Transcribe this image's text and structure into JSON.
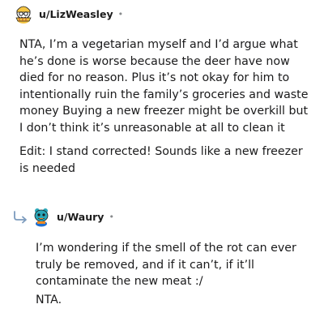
{
  "top_comment": {
    "username": "u/LizWeasley",
    "separator": "•",
    "body_paragraph_1": "NTA, I’m a vegetarian myself and I’d argue what he’s done is worse because the deer have now died for no reason. Plus it’s not okay for him to intentionally ruin the family’s groceries and waste money Buying a new freezer might be overkill but I don’t think it’s unreasonable at all to clean it",
    "body_paragraph_2": "Edit: I stand corrected! Sounds like a new freezer is needed",
    "avatar_icon": "snoo-avatar-icon"
  },
  "reply_comment": {
    "username": "u/Waury",
    "separator": "•",
    "body_paragraph_1": "I’m wondering if the smell of the rot can ever truly be removed, and if it can’t, if it’ll contaminate the new meat :/",
    "body_paragraph_2": "NTA.",
    "avatar_icon": "snoo-avatar-icon",
    "reply_indicator_icon": "reply-arrow-icon"
  },
  "colors": {
    "text": "#1a1a1b",
    "meta": "#878a8c",
    "reply_arrow": "#7c9bbd"
  }
}
